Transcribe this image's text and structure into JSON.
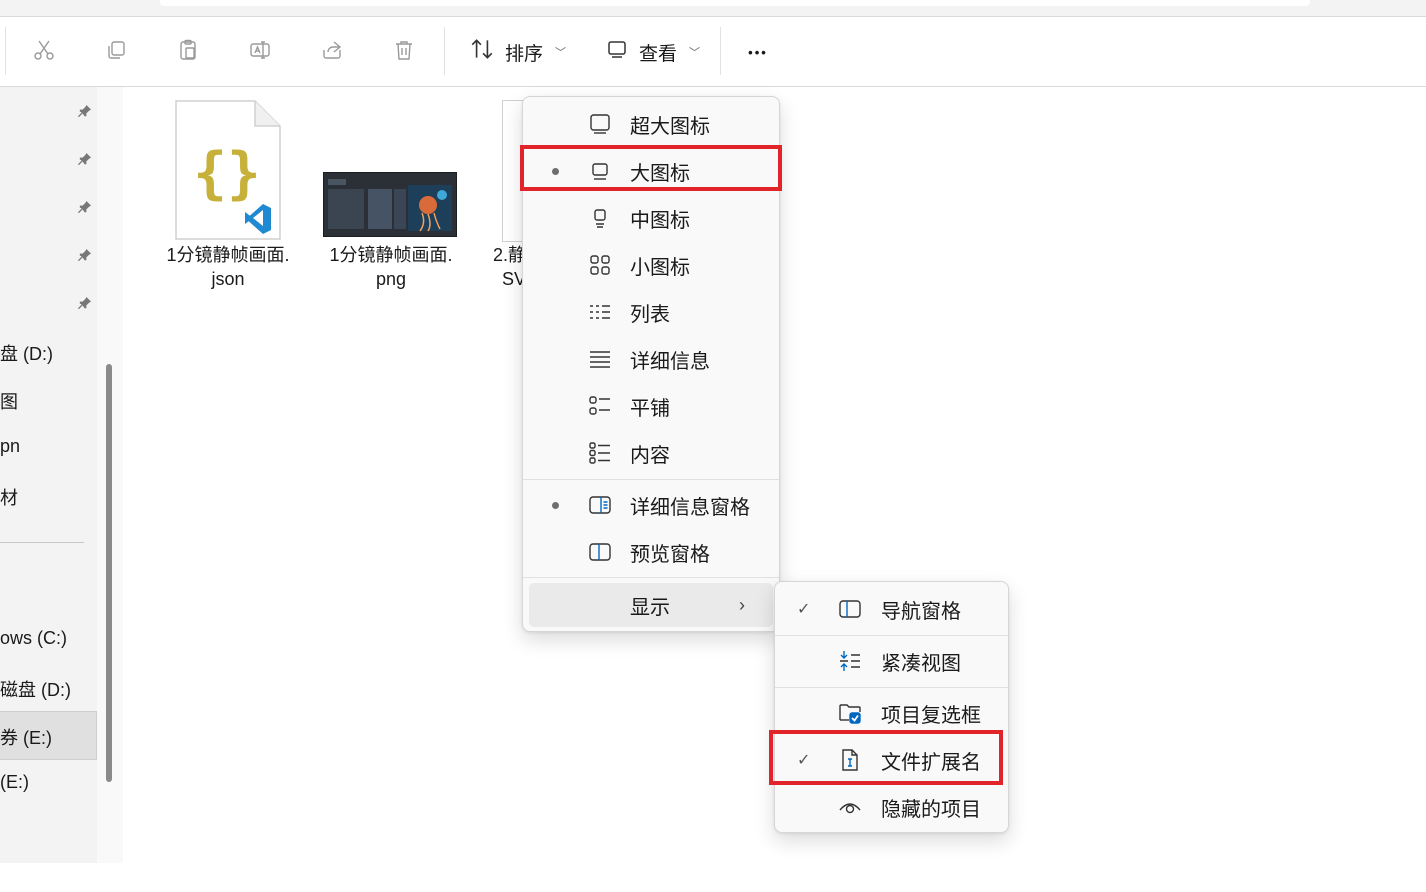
{
  "toolbar": {
    "sort_label": "排序",
    "view_label": "查看",
    "more_label": "•••"
  },
  "sidebar": {
    "drives": [
      "盘 (D:)",
      "图",
      "pn",
      "材",
      "ows (C:)",
      "磁盘 (D:)",
      "券 (E:)",
      "(E:)"
    ]
  },
  "files": [
    {
      "name_line1": "1分镜静帧画面.",
      "name_line2": "json"
    },
    {
      "name_line1": "1分镜静帧画面.",
      "name_line2": "png"
    },
    {
      "name_line1": "2.静",
      "name_line2": "SV"
    }
  ],
  "view_menu": {
    "items": [
      {
        "label": "超大图标",
        "icon": "monitor-icon"
      },
      {
        "label": "大图标",
        "icon": "monitor-icon",
        "selected": true
      },
      {
        "label": "中图标",
        "icon": "monitor-small-icon"
      },
      {
        "label": "小图标",
        "icon": "grid-icon"
      },
      {
        "label": "列表",
        "icon": "list-icon"
      },
      {
        "label": "详细信息",
        "icon": "details-icon"
      },
      {
        "label": "平铺",
        "icon": "tiles-icon"
      },
      {
        "label": "内容",
        "icon": "content-icon"
      },
      {
        "label": "详细信息窗格",
        "icon": "details-pane-icon",
        "selected": true
      },
      {
        "label": "预览窗格",
        "icon": "preview-pane-icon"
      },
      {
        "label": "显示",
        "icon": "",
        "submenu": true
      }
    ]
  },
  "show_submenu": {
    "items": [
      {
        "label": "导航窗格",
        "checked": true,
        "check": "✓"
      },
      {
        "label": "紧凑视图",
        "checked": false,
        "check": ""
      },
      {
        "label": "项目复选框",
        "checked": false,
        "check": ""
      },
      {
        "label": "文件扩展名",
        "checked": true,
        "check": "✓"
      },
      {
        "label": "隐藏的项目",
        "checked": false,
        "check": ""
      }
    ]
  },
  "colors": {
    "highlight": "#e0242a",
    "accent": "#0067c0"
  }
}
